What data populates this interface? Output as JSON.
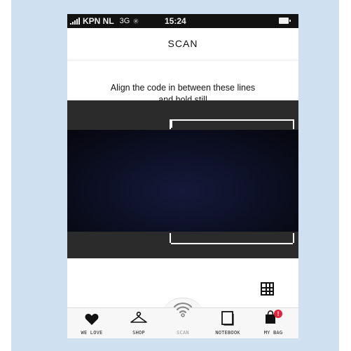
{
  "status_bar": {
    "carrier": "KPN NL",
    "network": "3G",
    "time": "15:24"
  },
  "nav": {
    "title": "SCAN"
  },
  "instruction": {
    "line1": "Align the code in between these lines",
    "line2": "and hold still"
  },
  "tabs": [
    {
      "label": "WE LOVE",
      "icon": "heart-icon"
    },
    {
      "label": "SHOP",
      "icon": "hanger-icon"
    },
    {
      "label": "SCAN",
      "icon": "wifi-scan-icon"
    },
    {
      "label": "NOTEBOOK",
      "icon": "notebook-icon"
    },
    {
      "label": "MY BAG",
      "icon": "bag-icon"
    }
  ],
  "colors": {
    "frame_background": "#cfe0f1",
    "scanner_dark": "#0c0f22",
    "badge": "#e0223a"
  }
}
